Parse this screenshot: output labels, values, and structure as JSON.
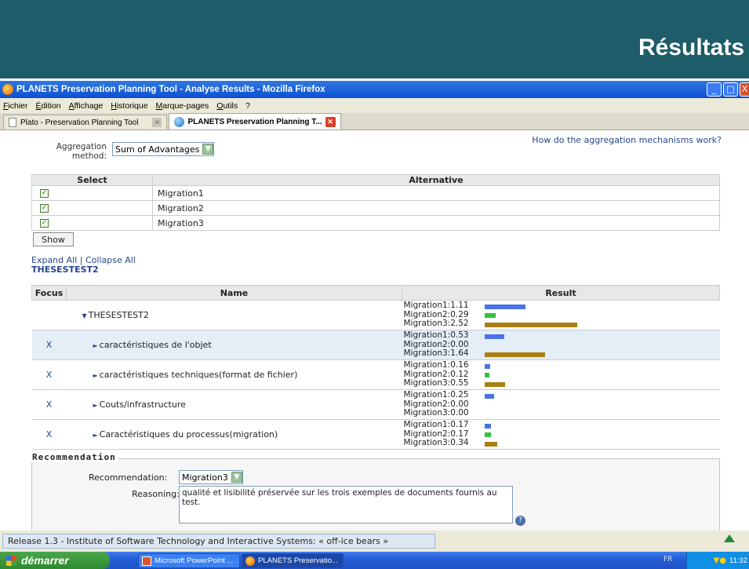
{
  "slide": {
    "title": "Résultats"
  },
  "window": {
    "title": "PLANETS Preservation Planning Tool - Analyse Results - Mozilla Firefox",
    "buttons": {
      "minimize": "_",
      "maximize": "□",
      "close": "X"
    }
  },
  "menubar": {
    "items": [
      "Fichier",
      "Édition",
      "Affichage",
      "Historique",
      "Marque-pages",
      "Outils",
      "?"
    ]
  },
  "tabs": [
    {
      "label": "Plato - Preservation Planning Tool",
      "active": false
    },
    {
      "label": "PLANETS Preservation Planning T...",
      "active": true
    }
  ],
  "aggregation": {
    "label": "Aggregation method:",
    "selected": "Sum of Advantages",
    "help_link": "How do the aggregation mechanisms work?"
  },
  "alternatives_table": {
    "headers": {
      "select": "Select",
      "alternative": "Alternative"
    },
    "rows": [
      {
        "checked": true,
        "name": "Migration1"
      },
      {
        "checked": true,
        "name": "Migration2"
      },
      {
        "checked": true,
        "name": "Migration3"
      }
    ],
    "show_button": "Show"
  },
  "tree_controls": {
    "expand_all": "Expand All",
    "separator": "|",
    "collapse_all": "Collapse All",
    "root_label": "THESESTEST2"
  },
  "results_table": {
    "headers": {
      "focus": "Focus",
      "name": "Name",
      "result": "Result"
    },
    "scale_max": 2.52,
    "series_colors": {
      "Migration1": "#4a72e6",
      "Migration2": "#33c23f",
      "Migration3": "#a97f12"
    },
    "rows": [
      {
        "focus": "",
        "name": "THESESTEST2",
        "arrow": "▼",
        "indent": 0,
        "highlight": false,
        "results": [
          {
            "alt": "Migration1",
            "text": "Migration1:1.11",
            "value": 1.11
          },
          {
            "alt": "Migration2",
            "text": "Migration2:0.29",
            "value": 0.29
          },
          {
            "alt": "Migration3",
            "text": "Migration3:2.52",
            "value": 2.52
          }
        ]
      },
      {
        "focus": "X",
        "name": "caractéristiques de l'objet",
        "arrow": "►",
        "indent": 1,
        "highlight": true,
        "results": [
          {
            "alt": "Migration1",
            "text": "Migration1:0.53",
            "value": 0.53
          },
          {
            "alt": "Migration2",
            "text": "Migration2:0.00",
            "value": 0.0
          },
          {
            "alt": "Migration3",
            "text": "Migration3:1.64",
            "value": 1.64
          }
        ]
      },
      {
        "focus": "X",
        "name": "caractéristiques techniques(format de fichier)",
        "arrow": "►",
        "indent": 1,
        "highlight": false,
        "results": [
          {
            "alt": "Migration1",
            "text": "Migration1:0.16",
            "value": 0.16
          },
          {
            "alt": "Migration2",
            "text": "Migration2:0.12",
            "value": 0.12
          },
          {
            "alt": "Migration3",
            "text": "Migration3:0.55",
            "value": 0.55
          }
        ]
      },
      {
        "focus": "X",
        "name": "Couts/infrastructure",
        "arrow": "►",
        "indent": 1,
        "highlight": false,
        "results": [
          {
            "alt": "Migration1",
            "text": "Migration1:0.25",
            "value": 0.25
          },
          {
            "alt": "Migration2",
            "text": "Migration2:0.00",
            "value": 0.0
          },
          {
            "alt": "Migration3",
            "text": "Migration3:0.00",
            "value": 0.0
          }
        ]
      },
      {
        "focus": "X",
        "name": "Caractéristiques du processus(migration)",
        "arrow": "►",
        "indent": 1,
        "highlight": false,
        "results": [
          {
            "alt": "Migration1",
            "text": "Migration1:0.17",
            "value": 0.17
          },
          {
            "alt": "Migration2",
            "text": "Migration2:0.17",
            "value": 0.17
          },
          {
            "alt": "Migration3",
            "text": "Migration3:0.34",
            "value": 0.34
          }
        ]
      }
    ]
  },
  "recommendation": {
    "legend": "Recommendation",
    "label": "Recommendation:",
    "selected": "Migration3",
    "reasoning_label": "Reasoning:",
    "reasoning_text": "qualité et lisibilité préservée sur les trois exemples de documents fournis au test.",
    "help_icon": "?"
  },
  "statusbar": {
    "text": "Release 1.3 - Institute of Software Technology and Interactive Systems: « off-ice bears »"
  },
  "taskbar": {
    "start_label": "démarrer",
    "tasks": [
      {
        "label": "Microsoft PowerPoint ...",
        "active": false
      },
      {
        "label": "PLANETS Preservatio...",
        "active": true
      }
    ],
    "language": "FR",
    "clock": "11:32"
  }
}
